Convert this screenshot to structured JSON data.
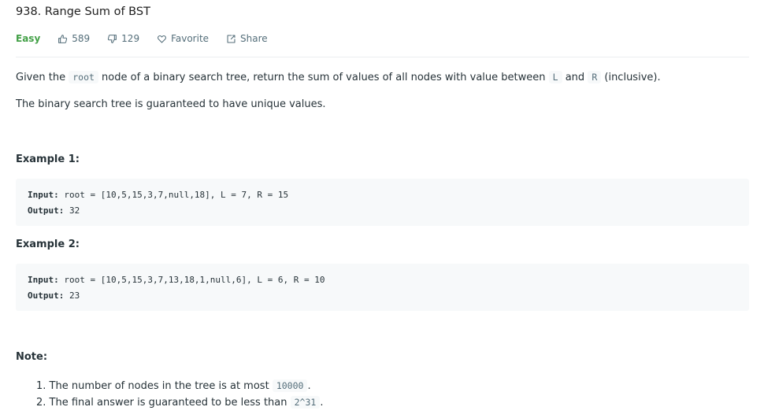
{
  "problem": {
    "title": "938. Range Sum of BST",
    "difficulty": "Easy",
    "likes": "589",
    "dislikes": "129",
    "favorite_label": "Favorite",
    "share_label": "Share"
  },
  "description": {
    "p1_a": "Given the ",
    "p1_code_root": "root",
    "p1_b": " node of a binary search tree, return the sum of values of all nodes with value between ",
    "p1_code_L": "L",
    "p1_c": " and ",
    "p1_code_R": "R",
    "p1_d": " (inclusive).",
    "p2": "The binary search tree is guaranteed to have unique values."
  },
  "examples": [
    {
      "heading": "Example 1:",
      "input_label": "Input:",
      "input_value": " root = [10,5,15,3,7,null,18], L = 7, R = 15",
      "output_label": "Output:",
      "output_value": " 32"
    },
    {
      "heading": "Example 2:",
      "input_label": "Input:",
      "input_value": " root = [10,5,15,3,7,13,18,1,null,6], L = 6, R = 10",
      "output_label": "Output:",
      "output_value": " 23"
    }
  ],
  "note": {
    "heading": "Note:",
    "items": [
      {
        "num": "1. ",
        "text": "The number of nodes in the tree is at most ",
        "code": "10000",
        "end": "."
      },
      {
        "num": "2. ",
        "text": "The final answer is guaranteed to be less than ",
        "code": "2^31",
        "end": "."
      }
    ]
  },
  "colors": {
    "easy": "#43a047",
    "text": "#263238",
    "muted": "#546e7a",
    "code_bg": "#f7f9fa"
  },
  "icons": [
    "thumbs-up-icon",
    "thumbs-down-icon",
    "heart-icon",
    "share-icon"
  ]
}
